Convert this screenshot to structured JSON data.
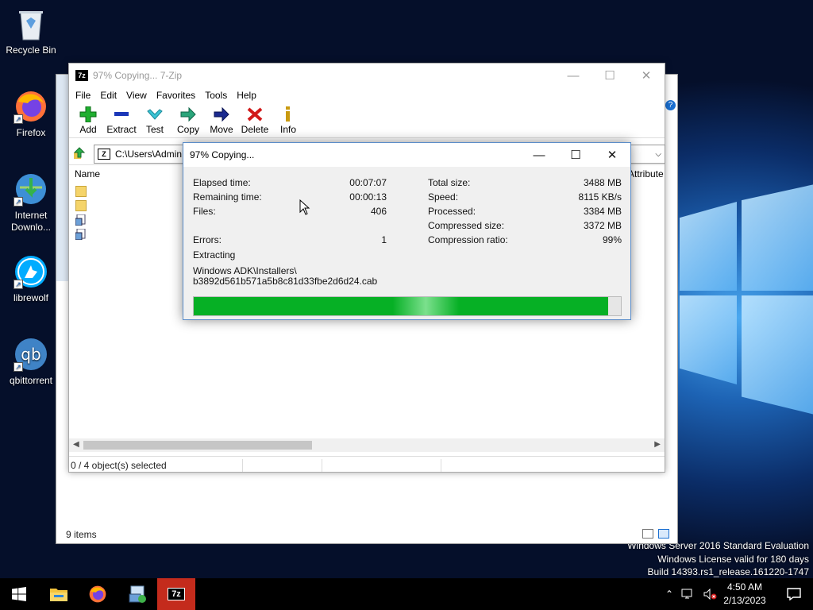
{
  "desktop": {
    "icons": [
      {
        "label": "Recycle Bin"
      },
      {
        "label": "Firefox"
      },
      {
        "label": "Internet Downlo..."
      },
      {
        "label": "librewolf"
      },
      {
        "label": "qbittorrent"
      }
    ],
    "watermark": {
      "line1": "Windows Server 2016 Standard Evaluation",
      "line2": "Windows License valid for 180 days",
      "line3": "Build 14393.rs1_release.161220-1747"
    }
  },
  "explorer": {
    "footer": "9 items"
  },
  "zip": {
    "title": "97% Copying... 7-Zip",
    "app_icon": "7z",
    "menu": [
      "File",
      "Edit",
      "View",
      "Favorites",
      "Tools",
      "Help"
    ],
    "toolbar": [
      "Add",
      "Extract",
      "Test",
      "Copy",
      "Move",
      "Delete",
      "Info"
    ],
    "address": "C:\\Users\\Admin",
    "columns": {
      "name": "Name",
      "attributes": "Attribute"
    },
    "status": "0 / 4 object(s) selected"
  },
  "dialog": {
    "title": "97% Copying...",
    "elapsed_label": "Elapsed time:",
    "elapsed_value": "00:07:07",
    "remaining_label": "Remaining time:",
    "remaining_value": "00:00:13",
    "files_label": "Files:",
    "files_value": "406",
    "errors_label": "Errors:",
    "errors_value": "1",
    "total_label": "Total size:",
    "total_value": "3488 MB",
    "speed_label": "Speed:",
    "speed_value": "8115 KB/s",
    "processed_label": "Processed:",
    "processed_value": "3384 MB",
    "compressed_label": "Compressed size:",
    "compressed_value": "3372 MB",
    "ratio_label": "Compression ratio:",
    "ratio_value": "99%",
    "operation": "Extracting",
    "path_line1": "Windows ADK\\Installers\\",
    "path_line2": "b3892d561b571a5b8c81d33fbe2d6d24.cab",
    "progress": 0.97
  },
  "taskbar": {
    "app_7z_label": "7z",
    "time": "4:50 AM",
    "date": "2/13/2023"
  },
  "colors": {
    "progress": "#06b025",
    "taskbar": "#000000",
    "active_task": "#c42b1c"
  }
}
